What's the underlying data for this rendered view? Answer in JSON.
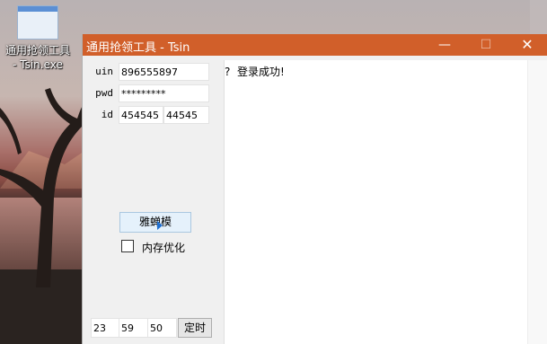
{
  "desktop": {
    "icon_label_line1": "通用抢领工具",
    "icon_label_line2": "- Tsin.exe"
  },
  "window": {
    "title": "通用抢领工具 - Tsin",
    "controls": {
      "minimize": "—",
      "maximize": "☐",
      "close": "✕"
    },
    "titlebar_color": "#d15f2a"
  },
  "form": {
    "uin_label": "uin",
    "uin_value": "896555897",
    "pwd_label": "pwd",
    "pwd_value": "*********",
    "id_label": "id",
    "id_value_1": "454545",
    "id_value_2": "44545"
  },
  "log": {
    "line1": "?  登录成功!"
  },
  "actions": {
    "main_button_label": "雅蝉模",
    "checkbox_label": "内存优化",
    "checkbox_checked": false
  },
  "timer": {
    "hour": "23",
    "minute": "59",
    "second": "50",
    "button_label": "定时"
  }
}
